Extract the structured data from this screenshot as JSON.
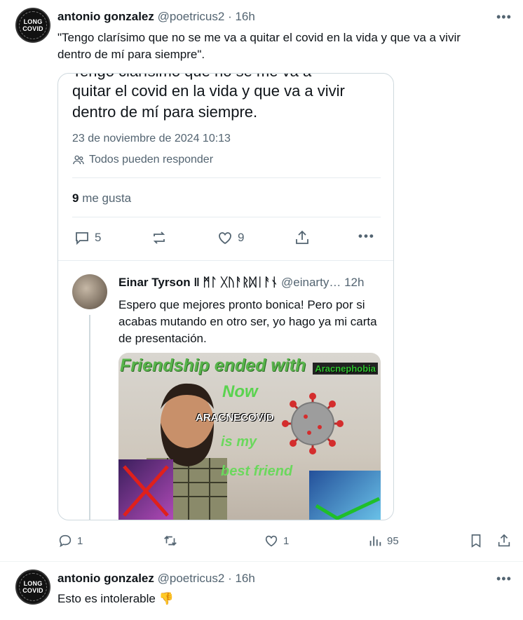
{
  "tweet1": {
    "avatar_top": "LONG",
    "avatar_bottom": "COVID",
    "name": "antonio gonzalez",
    "handle": "@poetricus2",
    "time": "· 16h",
    "text_line1": "\"Tengo clarísimo que no se me va a quitar el covid en la vida y que va a vivir",
    "text_line2": "dentro de mí para siempre\".",
    "more": "•••"
  },
  "card": {
    "big_line0": "Tengo clarísimo que no se me va a",
    "big_line1": "quitar el covid en la vida y que va a vivir",
    "big_line2": "dentro de mí para siempre.",
    "date": "23 de noviembre de 2024 10:13",
    "reply_setting": "Todos pueden responder",
    "likes_count": "9",
    "likes_label": " me gusta",
    "actions": {
      "replies": "5",
      "likes": "9"
    },
    "reply": {
      "name": "Einar Tyrson ‖ ᛗᛚ ᚷᚢᚨᚱᛞᛁᚨᚾ",
      "handle": "@einarty…",
      "time": "12h",
      "text": "Espero que mejores pronto bonica! Pero por si acabas mutando en otro ser, yo hago ya mi carta de presentación."
    },
    "meme": {
      "line1": "Friendship ended with",
      "tag": "Aracnephobia",
      "now": "Now",
      "label": "ARACNECOVID",
      "is_my": "is my",
      "best_friend": "best friend"
    }
  },
  "actionbar": {
    "replies": "1",
    "likes": "1",
    "views": "95"
  },
  "tweet2": {
    "avatar_top": "LONG",
    "avatar_bottom": "COVID",
    "name": "antonio gonzalez",
    "handle": "@poetricus2",
    "time": "· 16h",
    "text": "Esto es intolerable",
    "emoji": "👎",
    "more": "•••"
  },
  "colors": {
    "text": "#0f1419",
    "secondary": "#536471",
    "border": "#cfd9de"
  }
}
